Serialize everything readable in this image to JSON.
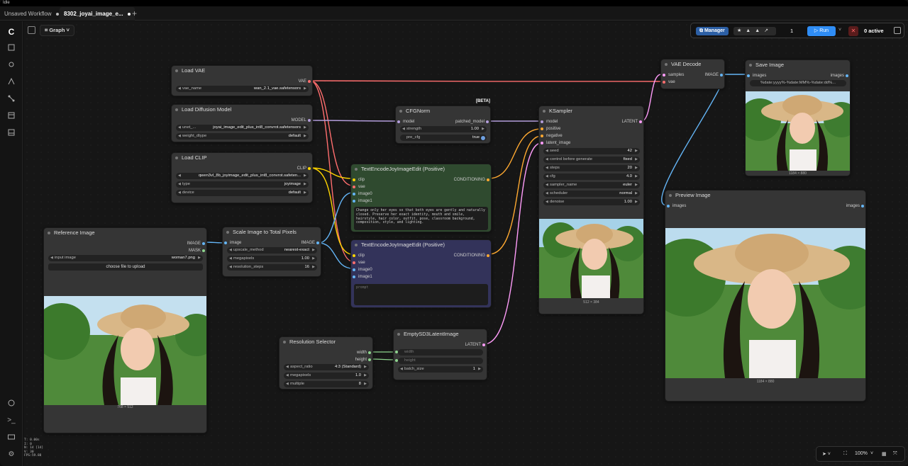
{
  "window": {
    "title": "Idle"
  },
  "tabs": [
    {
      "label": "Unsaved Workflow"
    },
    {
      "label": "8302_joyai_image_e..."
    }
  ],
  "toolbar": {
    "graph_label": "Graph",
    "manager_label": "Manager",
    "run_count": "1",
    "run_label": "Run",
    "active_label": "0 active",
    "zoom": "100%"
  },
  "stats": [
    "T: 0.00s",
    "I: 0",
    "N: 14 [14]",
    "V: 30",
    "FPS:59.88"
  ],
  "colors": {
    "accent": "#2f8df5",
    "wire_vae": "#ff6e6e",
    "wire_image": "#64b5f6",
    "wire_clip": "#ffd500",
    "wire_conditioning": "#ffa931",
    "wire_latent": "#ff9cf9",
    "wire_model": "#b39ddb"
  },
  "nodes": {
    "load_vae": {
      "title": "Load VAE",
      "out": "VAE",
      "w_label": "vae_name",
      "w_value": "wan_2.1_vae.safetensors"
    },
    "load_diffusion": {
      "title": "Load Diffusion Model",
      "out": "MODEL",
      "w1_label": "unet_...",
      "w1_value": "joyai_image_edit_plus_int8_convrot.safetensors",
      "w2_label": "weight_dtype",
      "w2_value": "default"
    },
    "load_clip": {
      "title": "Load CLIP",
      "out": "CLIP",
      "w1_label": "",
      "w1_value": "qwen3vl_8b_joyimage_edit_plus_int8_convrot.safeten...",
      "w2_label": "type",
      "w2_value": "joyimage",
      "w3_label": "device",
      "w3_value": "default"
    },
    "cfgnorm": {
      "title": "CFGNorm",
      "badge": "[BETA]",
      "in": "model",
      "out": "patched_model",
      "w1_label": "strength",
      "w1_value": "1.00",
      "w2_label": "pre_cfg",
      "w2_value": "true"
    },
    "text_pos": {
      "title": "TextEncodeJoyImageEdit (Positive)",
      "out": "CONDITIONING",
      "in1": "clip",
      "in2": "vae",
      "in3": "image0",
      "in4": "image1",
      "prompt": "Change only her eyes so that both eyes are gently and naturally closed. Preserve her exact identity, mouth and smile, hairstyle, hair color, outfit, pose, classroom background, composition, style, and lighting."
    },
    "text_neg": {
      "title": "TextEncodeJoyImageEdit (Positive)",
      "out": "CONDITIONING",
      "in1": "clip",
      "in2": "vae",
      "in3": "image0",
      "in4": "image1",
      "placeholder": "prompt"
    },
    "ksampler": {
      "title": "KSampler",
      "out": "LATENT",
      "in1": "model",
      "in2": "positive",
      "in3": "negative",
      "in4": "latent_image",
      "widgets": [
        {
          "label": "seed",
          "value": "42"
        },
        {
          "label": "control before generate",
          "value": "fixed"
        },
        {
          "label": "steps",
          "value": "20"
        },
        {
          "label": "cfg",
          "value": "4.0"
        },
        {
          "label": "sampler_name",
          "value": "euler"
        },
        {
          "label": "scheduler",
          "value": "normal"
        },
        {
          "label": "denoise",
          "value": "1.00"
        }
      ],
      "caption": "512 × 384"
    },
    "vae_decode": {
      "title": "VAE Decode",
      "in1": "samples",
      "in2": "vae",
      "out": "IMAGE"
    },
    "save_image": {
      "title": "Save Image",
      "in": "images",
      "out": "images",
      "filename": "%date:yyyy%-%date:MM%-%date:dd%...",
      "caption": "1184 × 880"
    },
    "preview_image": {
      "title": "Preview Image",
      "in": "images",
      "out": "images",
      "caption": "1184 × 880"
    },
    "reference_image": {
      "title": "Reference Image",
      "out1": "IMAGE",
      "out2": "MASK",
      "w_label": "input image",
      "w_value": "woman7.png",
      "upload": "choose file to upload",
      "caption": "768 × 512"
    },
    "scale_image": {
      "title": "Scale Image to Total Pixels",
      "in": "image",
      "out": "IMAGE",
      "widgets": [
        {
          "label": "upscale_method",
          "value": "nearest-exact"
        },
        {
          "label": "megapixels",
          "value": "1.00"
        },
        {
          "label": "resolution_steps",
          "value": "16"
        }
      ]
    },
    "resolution_selector": {
      "title": "Resolution Selector",
      "out1": "width",
      "out2": "height",
      "widgets": [
        {
          "label": "aspect_ratio",
          "value": "4:3 (Standard)"
        },
        {
          "label": "megapixels",
          "value": "1.0"
        },
        {
          "label": "multiple",
          "value": "8"
        }
      ]
    },
    "empty_latent": {
      "title": "EmptySD3LatentImage",
      "out": "LATENT",
      "in1": "width",
      "in2": "height",
      "w_label": "batch_size",
      "w_value": "1"
    }
  }
}
